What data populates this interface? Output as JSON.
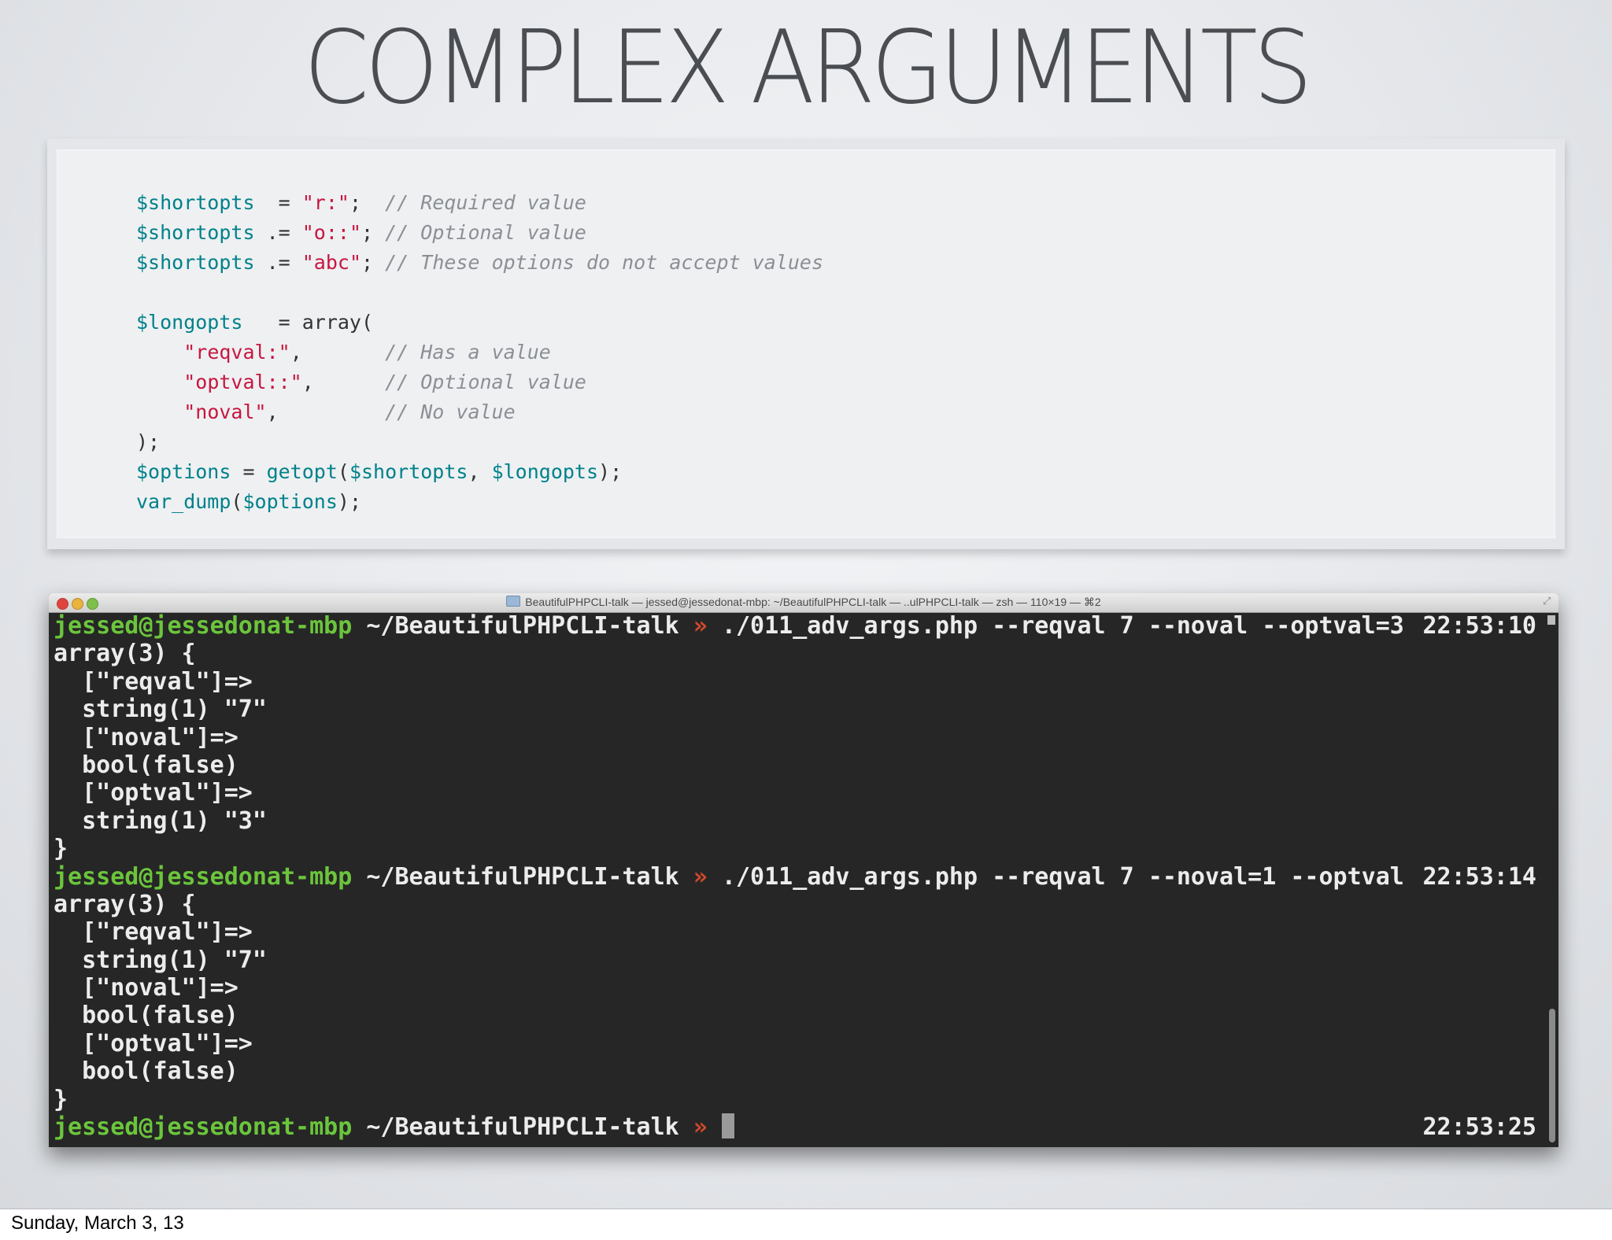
{
  "slide": {
    "title": "COMPLEX ARGUMENTS"
  },
  "code": {
    "lines": [
      [
        {
          "t": "v",
          "x": "$shortopts"
        },
        {
          "t": "p",
          "x": "  = "
        },
        {
          "t": "s",
          "x": "\"r:\""
        },
        {
          "t": "p",
          "x": ";  "
        },
        {
          "t": "c",
          "x": "// Required value"
        }
      ],
      [
        {
          "t": "v",
          "x": "$shortopts"
        },
        {
          "t": "p",
          "x": " .= "
        },
        {
          "t": "s",
          "x": "\"o::\""
        },
        {
          "t": "p",
          "x": "; "
        },
        {
          "t": "c",
          "x": "// Optional value"
        }
      ],
      [
        {
          "t": "v",
          "x": "$shortopts"
        },
        {
          "t": "p",
          "x": " .= "
        },
        {
          "t": "s",
          "x": "\"abc\""
        },
        {
          "t": "p",
          "x": "; "
        },
        {
          "t": "c",
          "x": "// These options do not accept values"
        }
      ],
      [],
      [
        {
          "t": "v",
          "x": "$longopts"
        },
        {
          "t": "p",
          "x": "   = array("
        }
      ],
      [
        {
          "t": "p",
          "x": "    "
        },
        {
          "t": "s",
          "x": "\"reqval:\""
        },
        {
          "t": "p",
          "x": ",       "
        },
        {
          "t": "c",
          "x": "// Has a value"
        }
      ],
      [
        {
          "t": "p",
          "x": "    "
        },
        {
          "t": "s",
          "x": "\"optval::\""
        },
        {
          "t": "p",
          "x": ",      "
        },
        {
          "t": "c",
          "x": "// Optional value"
        }
      ],
      [
        {
          "t": "p",
          "x": "    "
        },
        {
          "t": "s",
          "x": "\"noval\""
        },
        {
          "t": "p",
          "x": ",         "
        },
        {
          "t": "c",
          "x": "// No value"
        }
      ],
      [
        {
          "t": "p",
          "x": ");"
        }
      ],
      [
        {
          "t": "v",
          "x": "$options"
        },
        {
          "t": "p",
          "x": " = "
        },
        {
          "t": "v",
          "x": "getopt"
        },
        {
          "t": "p",
          "x": "("
        },
        {
          "t": "v",
          "x": "$shortopts"
        },
        {
          "t": "p",
          "x": ", "
        },
        {
          "t": "v",
          "x": "$longopts"
        },
        {
          "t": "p",
          "x": ");"
        }
      ],
      [
        {
          "t": "v",
          "x": "var_dump"
        },
        {
          "t": "p",
          "x": "("
        },
        {
          "t": "v",
          "x": "$options"
        },
        {
          "t": "p",
          "x": ");"
        }
      ]
    ]
  },
  "terminal": {
    "window_title": "BeautifulPHPCLI-talk — jessed@jessedonat-mbp: ~/BeautifulPHPCLI-talk — ..ulPHPCLI-talk — zsh — 110×19 — ⌘2",
    "colors": {
      "user": "#6bc53c",
      "arrow": "#d04a2c",
      "background": "#262626"
    },
    "lines": [
      {
        "kind": "prompt",
        "user": "jessed@jessedonat-mbp",
        "path": " ~/BeautifulPHPCLI-talk ",
        "arrow": "»",
        "cmd": " ./011_adv_args.php --reqval 7 --noval --optval=3",
        "time": "22:53:10"
      },
      {
        "kind": "out",
        "text": "array(3) {"
      },
      {
        "kind": "out",
        "text": "  [\"reqval\"]=>"
      },
      {
        "kind": "out",
        "text": "  string(1) \"7\""
      },
      {
        "kind": "out",
        "text": "  [\"noval\"]=>"
      },
      {
        "kind": "out",
        "text": "  bool(false)"
      },
      {
        "kind": "out",
        "text": "  [\"optval\"]=>"
      },
      {
        "kind": "out",
        "text": "  string(1) \"3\""
      },
      {
        "kind": "out",
        "text": "}"
      },
      {
        "kind": "prompt",
        "user": "jessed@jessedonat-mbp",
        "path": " ~/BeautifulPHPCLI-talk ",
        "arrow": "»",
        "cmd": " ./011_adv_args.php --reqval 7 --noval=1 --optval",
        "time": "22:53:14"
      },
      {
        "kind": "out",
        "text": "array(3) {"
      },
      {
        "kind": "out",
        "text": "  [\"reqval\"]=>"
      },
      {
        "kind": "out",
        "text": "  string(1) \"7\""
      },
      {
        "kind": "out",
        "text": "  [\"noval\"]=>"
      },
      {
        "kind": "out",
        "text": "  bool(false)"
      },
      {
        "kind": "out",
        "text": "  [\"optval\"]=>"
      },
      {
        "kind": "out",
        "text": "  bool(false)"
      },
      {
        "kind": "out",
        "text": "}"
      },
      {
        "kind": "prompt",
        "user": "jessed@jessedonat-mbp",
        "path": " ~/BeautifulPHPCLI-talk ",
        "arrow": "»",
        "cmd": " ",
        "time": "22:53:25",
        "cursor": true
      }
    ]
  },
  "footer": {
    "date": "Sunday, March 3, 13"
  }
}
